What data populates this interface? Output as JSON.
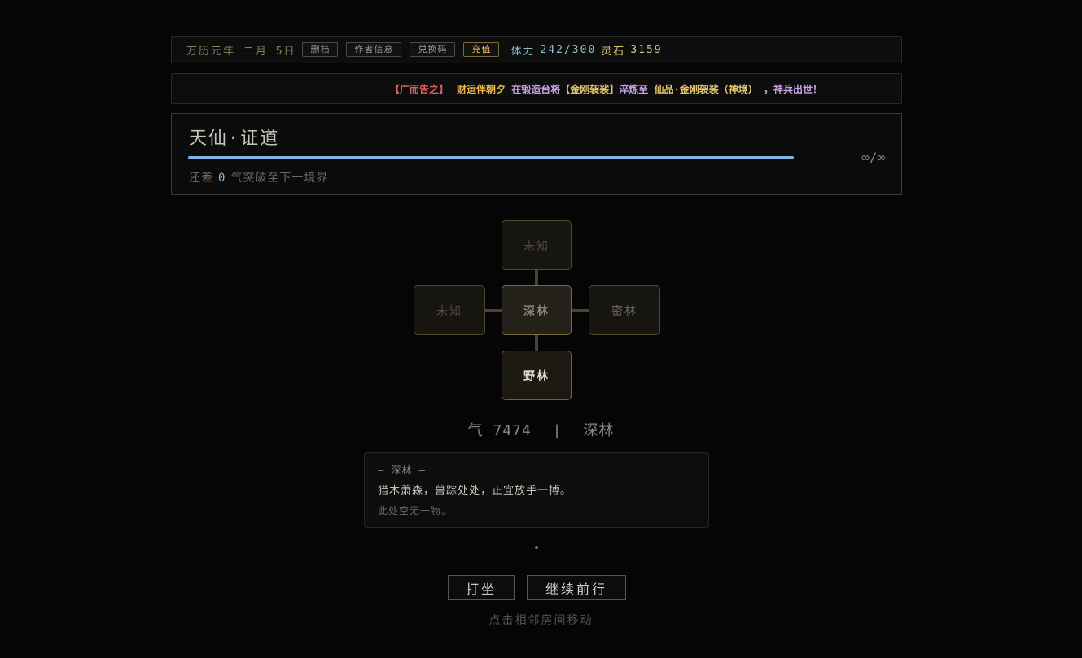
{
  "topbar": {
    "date": "万历元年 二月 5日",
    "buttons": [
      "删档",
      "作者信息",
      "兑换码",
      "充值"
    ],
    "stamina_label": "体力",
    "stamina_value": "242/300",
    "stone_label": "灵石",
    "stone_value": "3159"
  },
  "ticker": {
    "tag": "【广而告之】",
    "player": "财运伴朝夕",
    "text_before": " 在锻造台将",
    "item_from": "【金刚袈裟】",
    "text_mid": "淬炼至 ",
    "item_to": "仙品·金刚袈裟（神境）",
    "text_end": " ，神兵出世！"
  },
  "realm": {
    "title": "天仙·证道",
    "progress": 1.0,
    "cap": "∞/∞",
    "sub_before": "还差",
    "sub_num": "0",
    "sub_after": "气突破至下一境界"
  },
  "map": {
    "north": "未知",
    "west": "未知",
    "center": "深林",
    "east": "密林",
    "south": "野林"
  },
  "status": {
    "qi_label": "气",
    "qi_value": "7474",
    "separator": "|",
    "location": "深林"
  },
  "description": {
    "title": "— 深林 —",
    "body": "猎木萧森，兽踪处处，正宜放手一搏。",
    "note": "此处空无一物。"
  },
  "actions": {
    "meditate": "打坐",
    "continue": "继续前行"
  },
  "hint": "点击相邻房间移动"
}
